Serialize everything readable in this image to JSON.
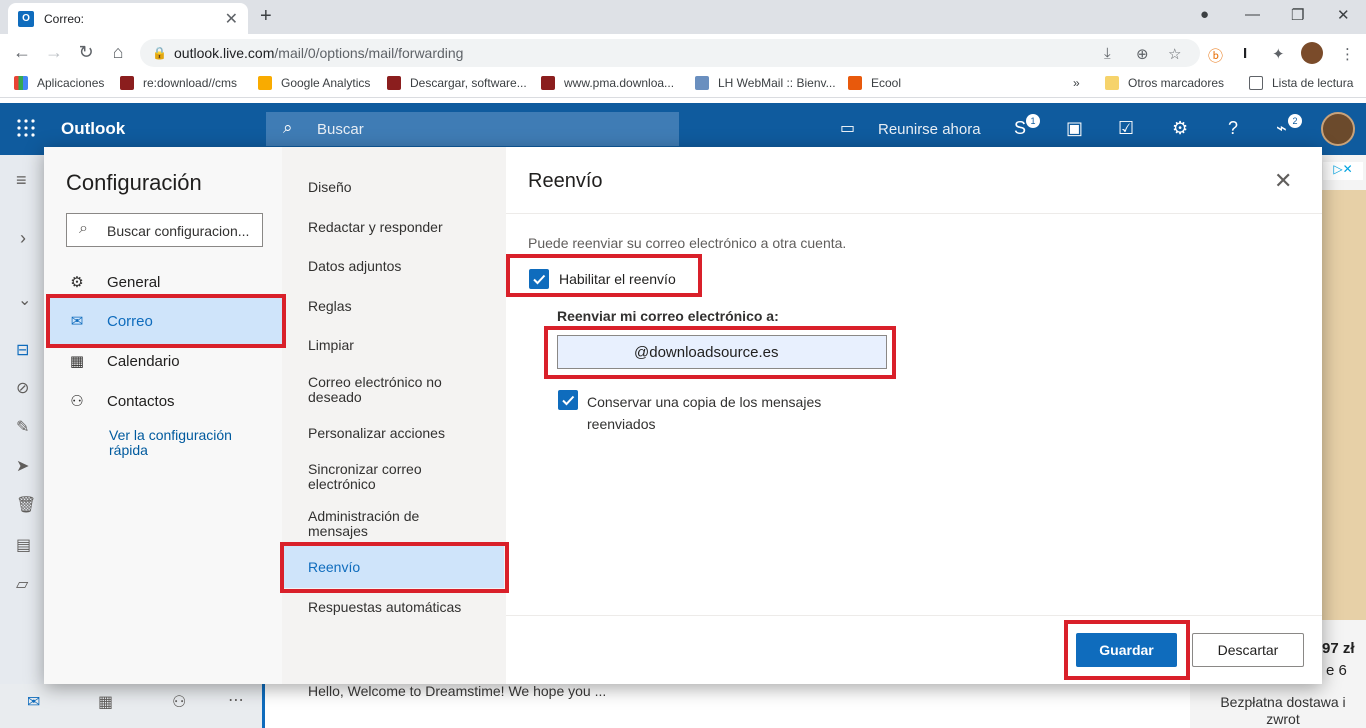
{
  "browser": {
    "tab_title": "Correo:",
    "url_host": "outlook.live.com",
    "url_path": "/mail/0/options/mail/forwarding",
    "bookmarks": [
      "Aplicaciones",
      "re:download//cms",
      "Google Analytics",
      "Descargar, software...",
      "www.pma.downloa...",
      "LH WebMail :: Bienv...",
      "Ecool"
    ],
    "other_bookmarks": "Otros marcadores",
    "reading_list": "Lista de lectura"
  },
  "outlook": {
    "app_name": "Outlook",
    "search_placeholder": "Buscar",
    "meet_now": "Reunirse ahora",
    "skype_badge": "1",
    "feedback_badge": "2",
    "preview_text": "Hello, Welcome to Dreamstime! We hope you ...",
    "ad_text": "Bezpłatna dostawa i zwrot",
    "ad_price": "97 zł",
    "ad_extra": "e 6"
  },
  "settings": {
    "title": "Configuración",
    "search_placeholder": "Buscar configuracion...",
    "nav": [
      "General",
      "Correo",
      "Calendario",
      "Contactos"
    ],
    "quick_settings": "Ver la configuración rápida",
    "subnav": [
      "Diseño",
      "Redactar y responder",
      "Datos adjuntos",
      "Reglas",
      "Limpiar",
      "Correo electrónico no deseado",
      "Personalizar acciones",
      "Sincronizar correo electrónico",
      "Administración de mensajes",
      "Reenvío",
      "Respuestas automáticas"
    ]
  },
  "forwarding": {
    "title": "Reenvío",
    "description": "Puede reenviar su correo electrónico a otra cuenta.",
    "enable_label": "Habilitar el reenvío",
    "enabled": true,
    "forward_to_label": "Reenviar mi correo electrónico a:",
    "forward_address": "@downloadsource.es",
    "keep_copy_label": "Conservar una copia de los mensajes reenviados",
    "keep_copy": true,
    "save": "Guardar",
    "discard": "Descartar"
  },
  "colors": {
    "brand": "#0f5b9e",
    "accent": "#0f6cbd",
    "highlight": "#d9202a",
    "selected": "#cfe4fa"
  }
}
